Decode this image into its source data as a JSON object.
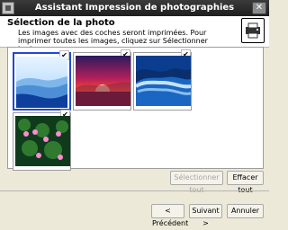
{
  "window": {
    "title": "Assistant Impression de photographies"
  },
  "header": {
    "title": "Sélection de la photo",
    "description": "Les images avec des coches seront imprimées. Pour imprimer toutes les images, cliquez sur Sélectionner tout."
  },
  "photos": [
    {
      "name": "blue-hills",
      "checked": true,
      "selected": true
    },
    {
      "name": "sunset",
      "checked": true,
      "selected": false
    },
    {
      "name": "wave",
      "checked": true,
      "selected": false
    },
    {
      "name": "water-lilies",
      "checked": true,
      "selected": false
    }
  ],
  "buttons": {
    "select_all": "Sélectionner tout",
    "clear_all": "Effacer tout",
    "previous": "< Précédent",
    "next": "Suivant >",
    "cancel": "Annuler"
  },
  "colors": {
    "selection_border": "#1d4ad8",
    "title_bar": "#2b2b2b"
  },
  "checkmark": "✔",
  "close_glyph": "✕"
}
